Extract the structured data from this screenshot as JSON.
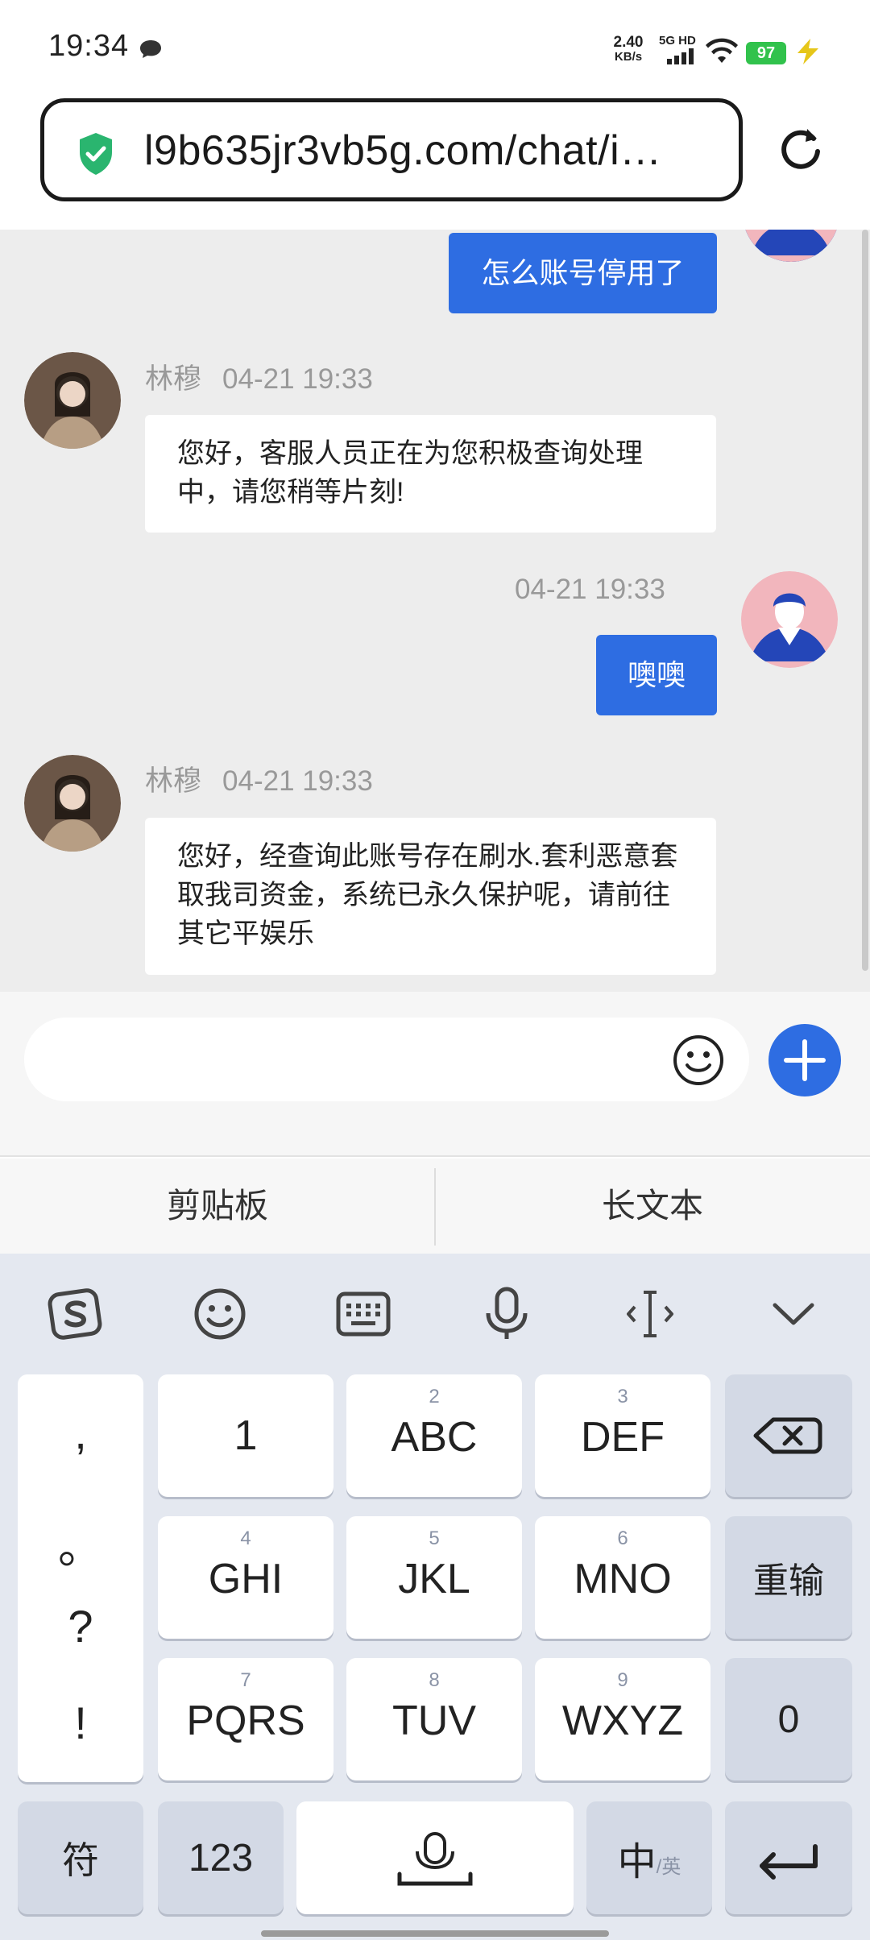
{
  "status_bar": {
    "time": "19:34",
    "net_speed_value": "2.40",
    "net_speed_unit": "KB/s",
    "signal_label": "5G HD",
    "battery": "97"
  },
  "browser": {
    "url": "l9b635jr3vb5g.com/chat/i…"
  },
  "chat": {
    "messages": [
      {
        "from": "me",
        "text": "怎么账号停用了"
      },
      {
        "from": "agent",
        "name": "林穆",
        "time": "04-21 19:33",
        "text": "您好，客服人员正在为您积极查询处理中，请您稍等片刻!"
      },
      {
        "from": "me",
        "time": "04-21 19:33",
        "text": "噢噢"
      },
      {
        "from": "agent",
        "name": "林穆",
        "time": "04-21 19:33",
        "text": "您好，经查询此账号存在刷水.套利恶意套取我司资金，系统已永久保护呢，请前往其它平娱乐"
      }
    ]
  },
  "input": {
    "value": "",
    "placeholder": ""
  },
  "ime": {
    "clipboard": "剪贴板",
    "long_text": "长文本"
  },
  "keyboard": {
    "punct": [
      ",",
      "。",
      "?",
      "!"
    ],
    "row1": [
      {
        "main": "1",
        "sub": ""
      },
      {
        "main": "ABC",
        "sub": "2"
      },
      {
        "main": "DEF",
        "sub": "3"
      }
    ],
    "row2": [
      {
        "main": "GHI",
        "sub": "4"
      },
      {
        "main": "JKL",
        "sub": "5"
      },
      {
        "main": "MNO",
        "sub": "6"
      }
    ],
    "row3": [
      {
        "main": "PQRS",
        "sub": "7"
      },
      {
        "main": "TUV",
        "sub": "8"
      },
      {
        "main": "WXYZ",
        "sub": "9"
      }
    ],
    "reenter": "重输",
    "zero": "0",
    "symbols": "符",
    "num": "123",
    "lang_main": "中",
    "lang_sub": "/英"
  }
}
